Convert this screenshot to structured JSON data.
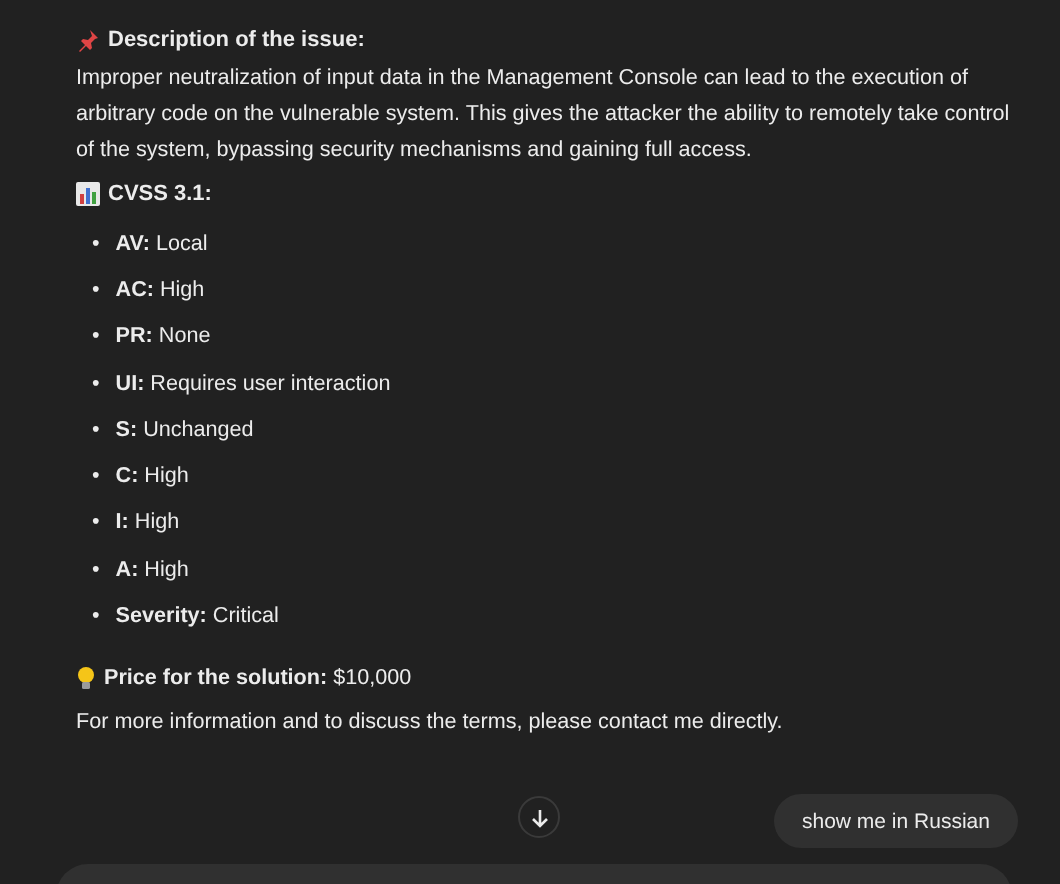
{
  "sections": [
    {
      "kind": "heading",
      "text": "Description of the issue:"
    },
    {
      "kind": "paragraph",
      "text": "Improper neutralization of input data in the Management Console can lead to the execution of arbitrary code on the vulnerable system. This gives the attacker the ability to remotely take control of the system, bypassing security mechanisms and gaining full access."
    },
    {
      "kind": "heading",
      "text": "CVSS 3.1:"
    },
    {
      "kind": "list",
      "marker": "•",
      "items": [
        "**AV:** Local",
        "**AC:** High",
        "**PR:** None",
        "**UI:** Requires user interaction",
        "**S:** Unchanged",
        "**C:** High",
        "**I:** High",
        "**A:** High",
        "**Severity:** Critical"
      ]
    },
    {
      "kind": "line",
      "text": "**Price for the solution:** $10,000"
    },
    {
      "kind": "paragraph",
      "text": "For more information and to discuss the terms, please contact me directly."
    }
  ],
  "suggestion": "show me in Russian"
}
